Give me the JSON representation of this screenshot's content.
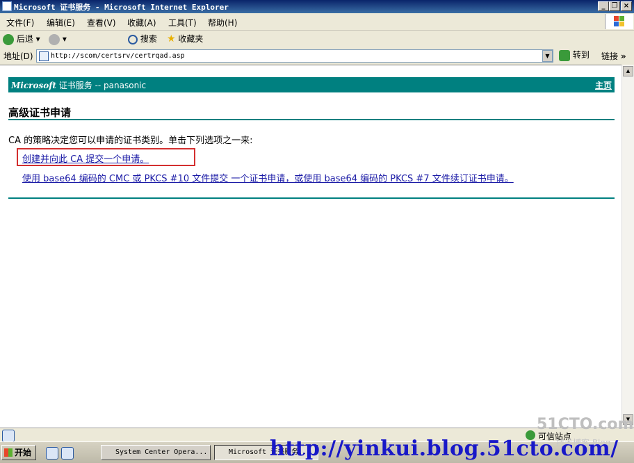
{
  "window": {
    "title": "Microsoft 证书服务 - Microsoft Internet Explorer"
  },
  "menu": [
    "文件(F)",
    "编辑(E)",
    "查看(V)",
    "收藏(A)",
    "工具(T)",
    "帮助(H)"
  ],
  "toolbar": {
    "back_label": "后退",
    "search_label": "搜索",
    "favorites_label": "收藏夹"
  },
  "address": {
    "label": "地址(D)",
    "url": "http://scom/certsrv/certrqad.asp",
    "go_label": "转到",
    "links_label": "链接"
  },
  "page": {
    "banner_ms": "Microsoft",
    "banner_rest": " 证书服务  --  panasonic",
    "home_link": "主页",
    "heading": "高级证书申请",
    "intro": "CA 的策略决定您可以申请的证书类别。单击下列选项之一来:",
    "link1": "创建并向此 CA 提交一个申请。",
    "link2": "使用 base64 编码的 CMC 或 PKCS #10 文件提交 一个证书申请，或使用 base64 编码的 PKCS #7 文件续订证书申请。"
  },
  "status": {
    "zone": "可信站点"
  },
  "taskbar": {
    "start_label": "开始",
    "tasks": [
      "System Center Opera...",
      "Microsoft 证书服务..."
    ]
  },
  "watermark": {
    "url": "http://yinkui.blog.51cto.com/",
    "site": "51CTO.com",
    "blog": "技术博客  Blog"
  },
  "colors": {
    "banner": "#008080",
    "link": "#1a1aa6",
    "highlight": "#d32f2f",
    "titlebar": "#0a246a"
  }
}
